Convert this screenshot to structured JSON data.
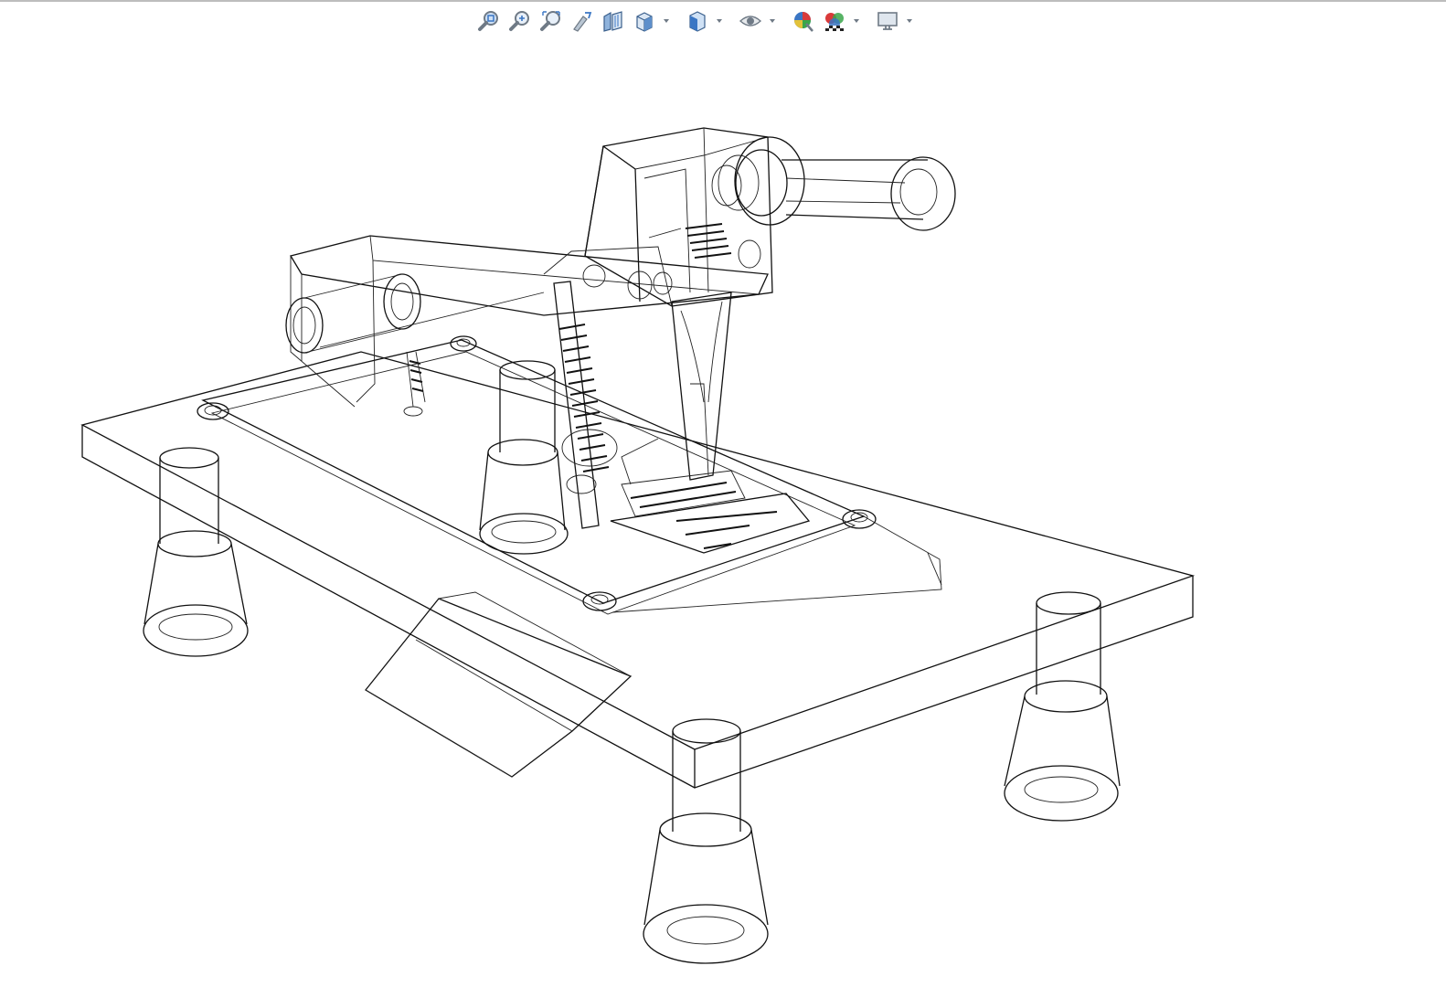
{
  "window": {
    "background": "#ffffff",
    "border_color": "#bdbdbd"
  },
  "toolbar": {
    "items": [
      {
        "icon": "zoom-to-fit-icon"
      },
      {
        "icon": "zoom-to-area-icon"
      },
      {
        "icon": "zoom-to-selection-icon"
      },
      {
        "icon": "previous-view-icon"
      },
      {
        "icon": "section-view-icon"
      },
      {
        "icon": "view-orientation-icon",
        "has_dropdown": true
      },
      {
        "icon": "display-style-icon",
        "has_dropdown": true
      },
      {
        "icon": "hide-show-items-icon",
        "has_dropdown": true
      },
      {
        "icon": "edit-appearance-icon"
      },
      {
        "icon": "apply-scene-icon",
        "has_dropdown": true
      },
      {
        "icon": "view-settings-icon",
        "has_dropdown": true
      }
    ],
    "colors": {
      "accent_blue": "#3a76c4",
      "icon_gray": "#6f7a86",
      "red": "#d93a3a",
      "green": "#3aa64a",
      "yellow": "#e3c23a"
    }
  },
  "model": {
    "display_style": "wireframe",
    "line_color": "#111111"
  }
}
